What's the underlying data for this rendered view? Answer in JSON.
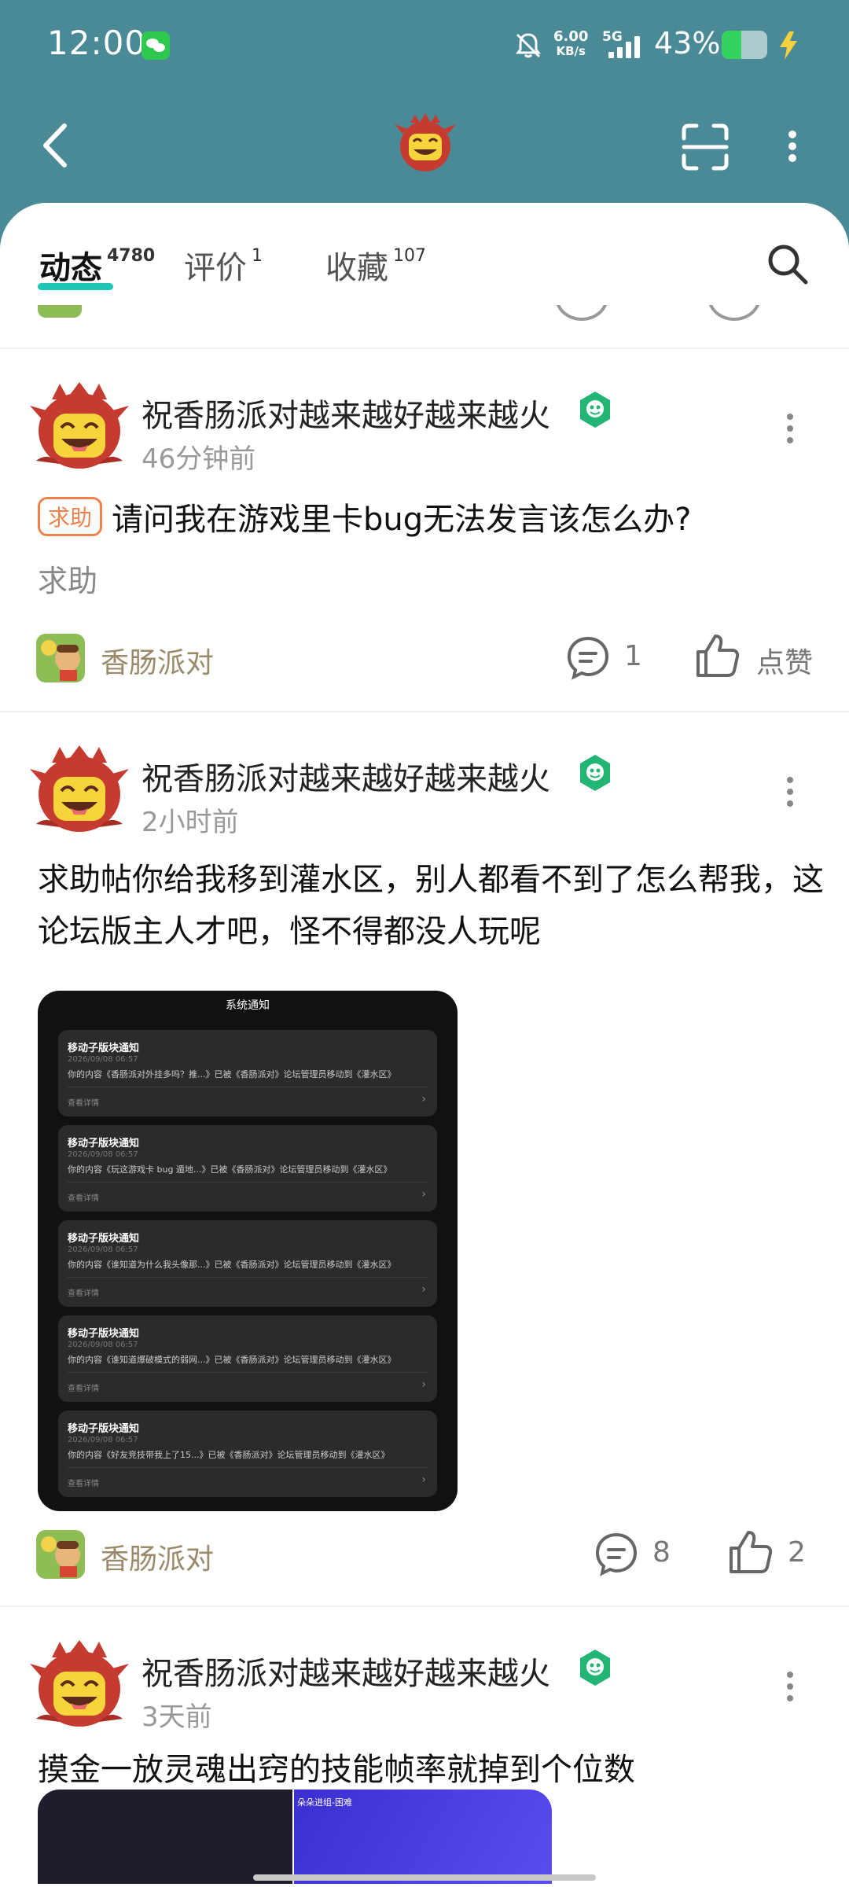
{
  "status_bar": {
    "time": "12:00",
    "net_speed_value": "6.00",
    "net_speed_unit": "KB/s",
    "network_type": "5G",
    "battery_percent": "43%",
    "battery_level": 0.43,
    "icons": [
      "wechat-icon",
      "bell-off-icon",
      "signal-icon",
      "battery-icon",
      "charging-icon"
    ]
  },
  "header": {
    "icons": [
      "back-icon",
      "game-logo-icon",
      "scan-icon",
      "more-vertical-icon"
    ]
  },
  "tabs": [
    {
      "label": "动态",
      "count": "4780",
      "active": true
    },
    {
      "label": "评价",
      "count": "1",
      "active": false
    },
    {
      "label": "收藏",
      "count": "107",
      "active": false
    }
  ],
  "posts": [
    {
      "user_name": "祝香肠派对越来越好越来越火",
      "time": "46分钟前",
      "tag": "求助",
      "title": "请问我在游戏里卡bug无法发言该怎么办?",
      "subtitle": "求助",
      "game": "香肠派对",
      "comment_count": "1",
      "like_label": "点赞"
    },
    {
      "user_name": "祝香肠派对越来越好越来越火",
      "time": "2小时前",
      "body": "求助帖你给我移到灌水区，别人都看不到了怎么帮我，这论坛版主人才吧，怪不得都没人玩呢",
      "image": {
        "title": "系统通知",
        "cards": [
          {
            "title": "移动子版块通知",
            "date": "2026/09/08 06:57",
            "body": "你的内容《香肠派对外挂多吗？推...》已被《香肠派对》论坛管理员移动到《灌水区》",
            "link": "查看详情"
          },
          {
            "title": "移动子版块通知",
            "date": "2026/09/08 06:57",
            "body": "你的内容《玩这游戏卡 bug 遁地...》已被《香肠派对》论坛管理员移动到《灌水区》",
            "link": "查看详情"
          },
          {
            "title": "移动子版块通知",
            "date": "2026/09/08 06:57",
            "body": "你的内容《谁知道为什么我头像那...》已被《香肠派对》论坛管理员移动到《灌水区》",
            "link": "查看详情"
          },
          {
            "title": "移动子版块通知",
            "date": "2026/09/08 06:57",
            "body": "你的内容《谁知道爆破模式的弱网...》已被《香肠派对》论坛管理员移动到《灌水区》",
            "link": "查看详情"
          },
          {
            "title": "移动子版块通知",
            "date": "2026/09/08 06:57",
            "body": "你的内容《好友竞技带我上了15...》已被《香肠派对》论坛管理员移动到《灌水区》",
            "link": "查看详情"
          }
        ]
      },
      "game": "香肠派对",
      "comment_count": "8",
      "like_count": "2"
    },
    {
      "user_name": "祝香肠派对越来越好越来越火",
      "time": "3天前",
      "body": "摸金一放灵魂出窍的技能帧率就掉到个位数",
      "thumb_caption": "朵朵进组-困难"
    }
  ],
  "colors": {
    "header_bg": "#4a8a96",
    "tab_indicator": "#1ec7b5",
    "tag_orange": "#f0814d",
    "game_name": "#9a8a6a",
    "badge_green": "#22b573",
    "battery_green": "#35d25e"
  }
}
